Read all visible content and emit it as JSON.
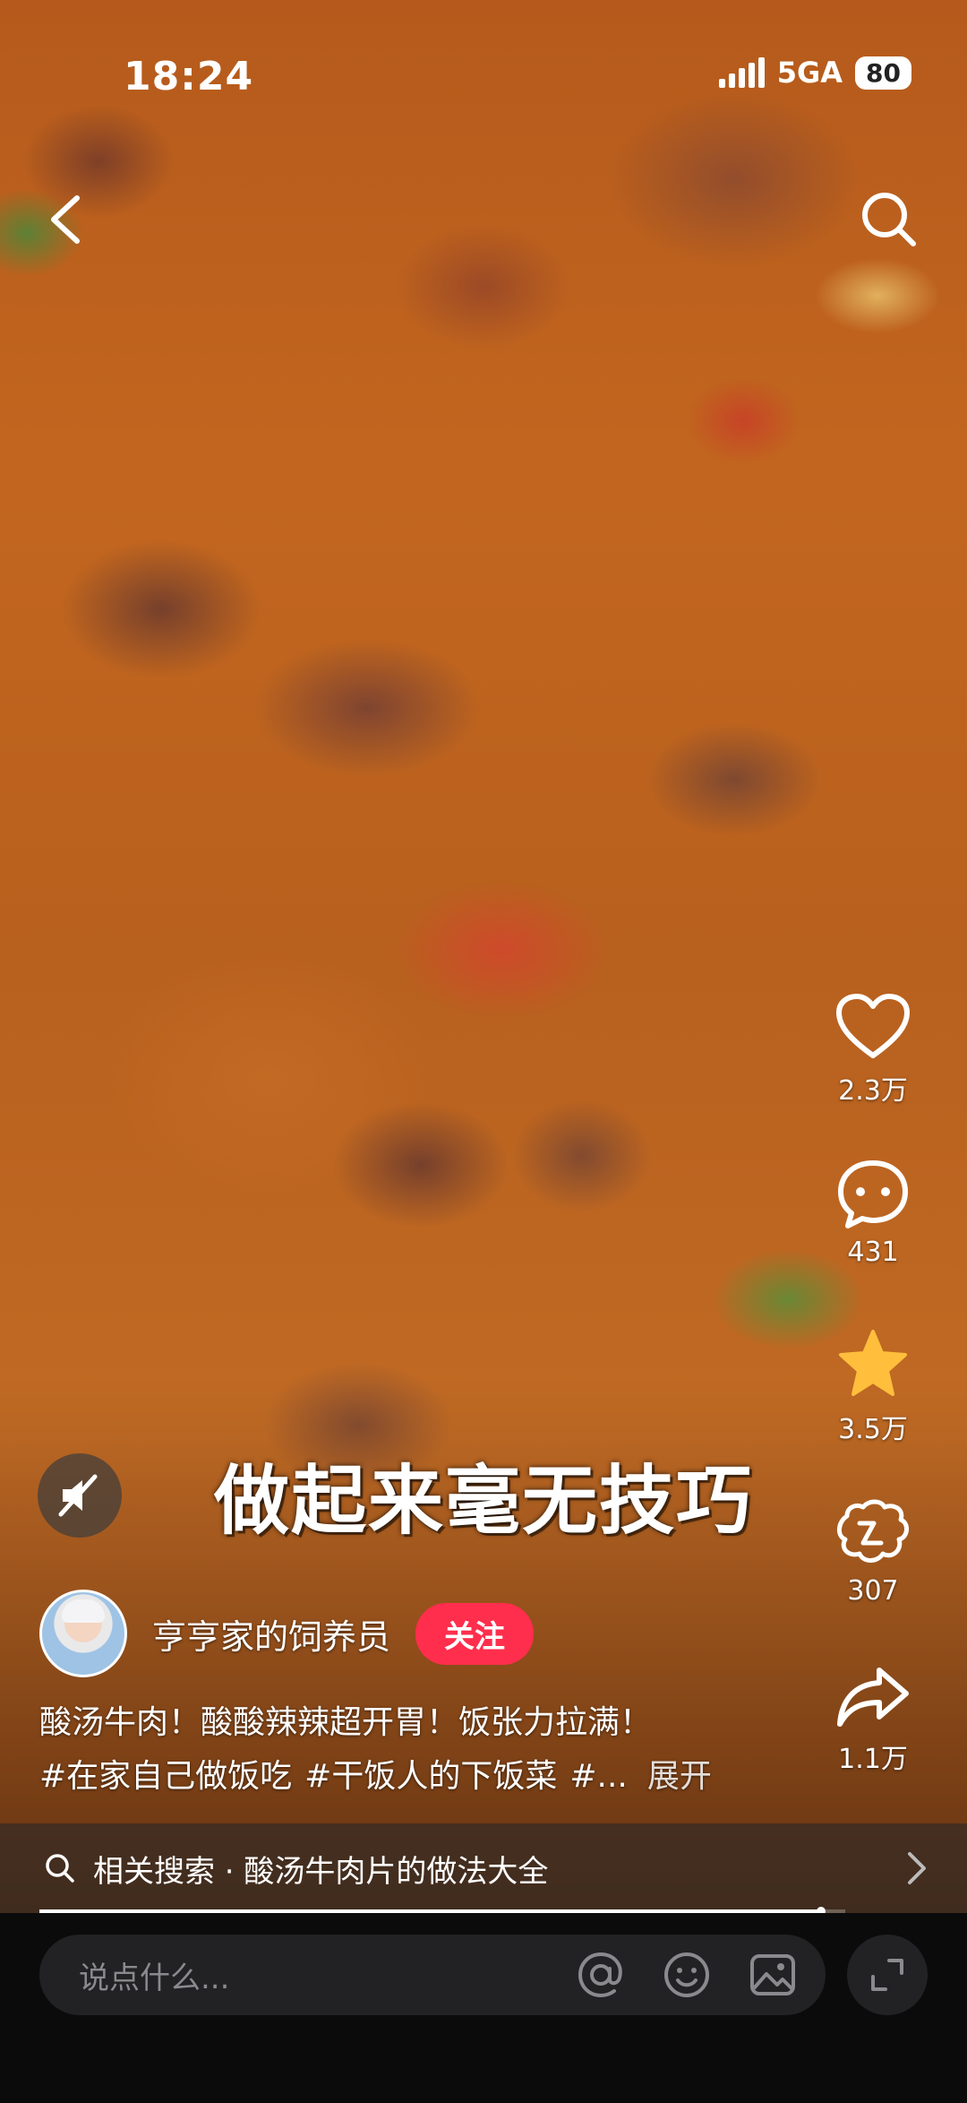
{
  "status_bar": {
    "time": "18:24",
    "network": "5GA",
    "battery": "80"
  },
  "caption": "做起来毫无技巧",
  "author": {
    "name": "亨亨家的饲养员",
    "follow_label": "关注"
  },
  "actions": {
    "like_count": "2.3万",
    "comment_count": "431",
    "favorite_count": "3.5万",
    "share_label_count": "307",
    "forward_count": "1.1万"
  },
  "description": {
    "text": "酸汤牛肉！酸酸辣辣超开胃！饭张力拉满！",
    "tags": [
      "#在家自己做饭吃",
      "#干饭人的下饭菜",
      "#..."
    ],
    "expand_label": "展开"
  },
  "related_search": {
    "text": "相关搜索 · 酸汤牛肉片的做法大全"
  },
  "comment_bar": {
    "placeholder": "说点什么..."
  },
  "playback_progress": 0.97,
  "colors": {
    "follow": "#ff2e4d",
    "favorite": "#ffbf3c"
  },
  "icons": [
    "back-arrow-icon",
    "search-icon",
    "heart-icon",
    "comment-bubble-icon",
    "star-icon",
    "share-icon",
    "forward-arrow-icon",
    "mute-icon",
    "at-icon",
    "emoji-icon",
    "image-icon",
    "fullscreen-icon"
  ]
}
